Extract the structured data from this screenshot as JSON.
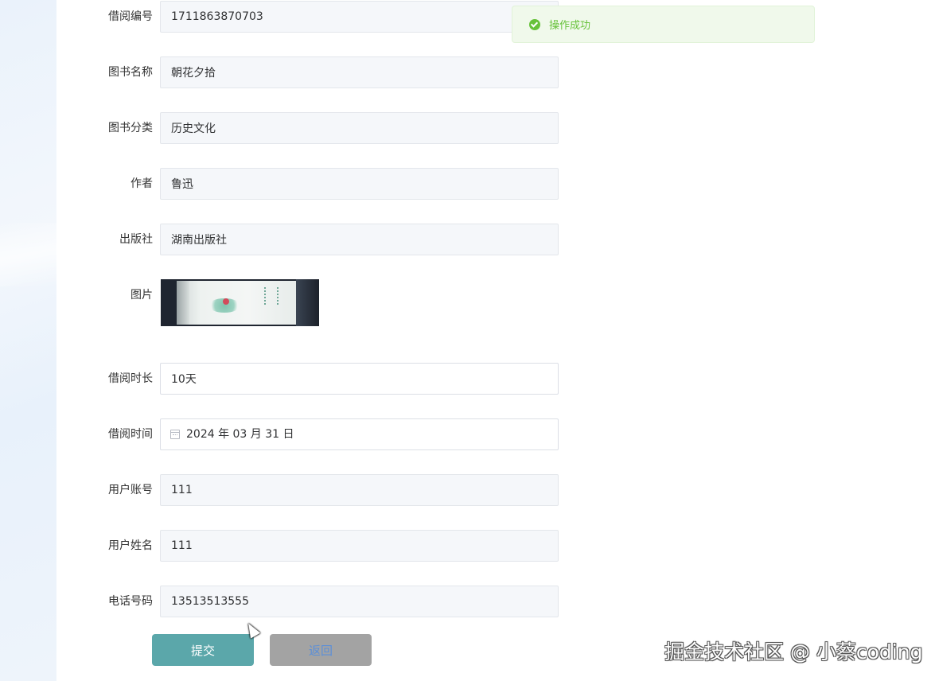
{
  "form": {
    "fields": [
      {
        "label": "借阅编号",
        "value": "1711863870703",
        "editable": false
      },
      {
        "label": "图书名称",
        "value": "朝花夕拾",
        "editable": false
      },
      {
        "label": "图书分类",
        "value": "历史文化",
        "editable": false
      },
      {
        "label": "作者",
        "value": "鲁迅",
        "editable": false
      },
      {
        "label": "出版社",
        "value": "湖南出版社",
        "editable": false
      }
    ],
    "image_label": "图片",
    "image_icon": "book-cover-image",
    "fields2": [
      {
        "label": "借阅时长",
        "value": "10天",
        "editable": true
      },
      {
        "label": "借阅时间",
        "value": "2024 年 03 月 31 日",
        "editable": true,
        "icon": "calendar-icon"
      },
      {
        "label": "用户账号",
        "value": "111",
        "editable": false
      },
      {
        "label": "用户姓名",
        "value": "111",
        "editable": false
      },
      {
        "label": "电话号码",
        "value": "13513513555",
        "editable": false
      }
    ],
    "submit_label": "提交",
    "back_label": "返回"
  },
  "toast": {
    "message": "操作成功",
    "icon": "success-check-icon",
    "color": "#67c23a"
  },
  "colors": {
    "submit_bg": "#5ba7aa",
    "back_bg": "#a3a3a3",
    "back_text": "#5b8fd8"
  },
  "watermark": {
    "text": "掘金技术社区 @ 小蔡coding"
  }
}
